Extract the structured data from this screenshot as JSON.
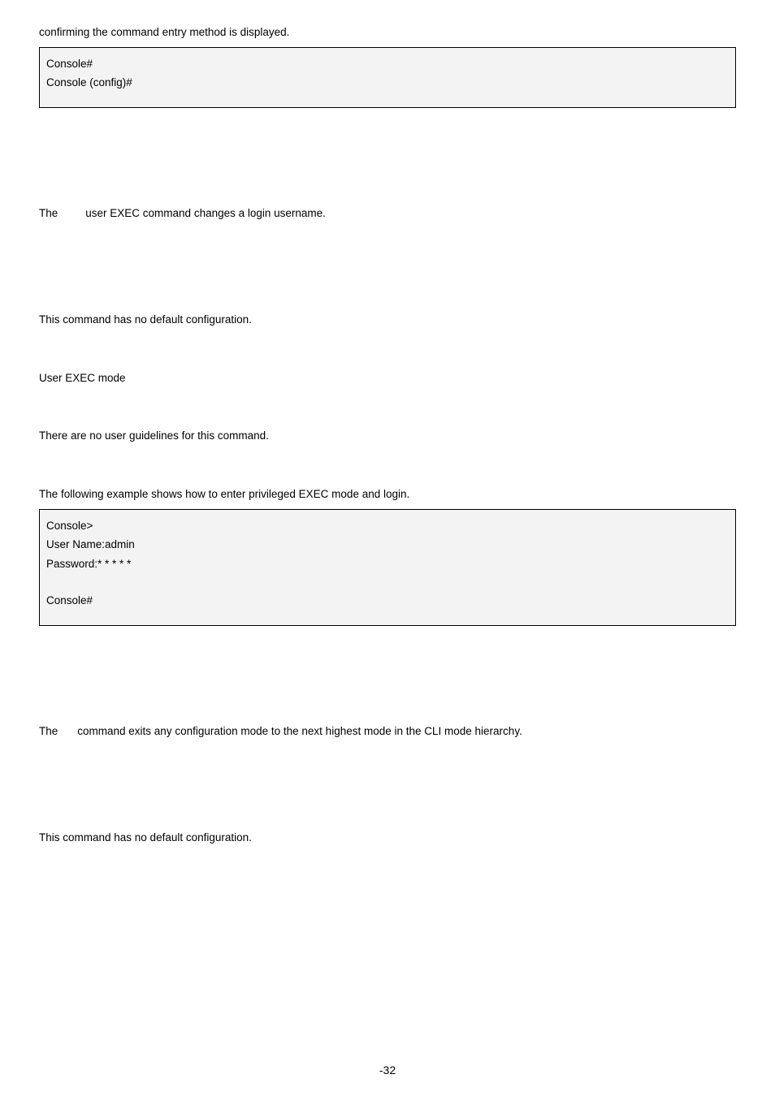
{
  "intro": {
    "text": "confirming the command entry method is displayed."
  },
  "codebox1": {
    "line1": "Console#",
    "line2": "Console (config)#"
  },
  "login_section": {
    "desc_prefix": "The",
    "desc_rest": "user EXEC command changes a login username.",
    "default_text": "This command has no default configuration.",
    "mode_text": "User EXEC mode",
    "guidelines_text": "There are no user guidelines for this command.",
    "example_intro": "The following example shows how to enter privileged EXEC mode and login."
  },
  "codebox2": {
    "line1": "Console>",
    "line2": "User Name:admin",
    "line3": "Password:* * * * *",
    "line4": "Console#"
  },
  "exit_section": {
    "desc_prefix": "The",
    "desc_rest": "command exits any configuration mode to the next highest mode in the CLI mode hierarchy.",
    "default_text": "This command has no default configuration."
  },
  "footer": {
    "page": "-32"
  }
}
